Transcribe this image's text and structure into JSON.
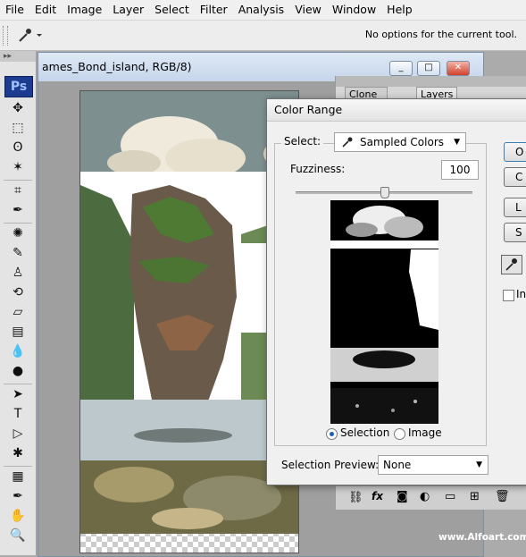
{
  "menu": [
    "File",
    "Edit",
    "Image",
    "Layer",
    "Select",
    "Filter",
    "Analysis",
    "View",
    "Window",
    "Help"
  ],
  "options_bar": {
    "message": "No options for the current tool.",
    "tool_icon": "eyedropper-icon"
  },
  "toolbox": {
    "logo": "Ps",
    "tools": [
      "move-icon",
      "marquee-icon",
      "lasso-icon",
      "magic-wand-icon",
      "crop-icon",
      "eyedropper-icon",
      "healing-brush-icon",
      "brush-icon",
      "clone-stamp-icon",
      "history-brush-icon",
      "eraser-icon",
      "gradient-icon",
      "blur-icon",
      "dodge-icon",
      "path-selection-icon",
      "type-icon",
      "direct-selection-icon",
      "custom-shape-icon",
      "notes-icon",
      "eyedropper-icon",
      "hand-icon",
      "zoom-icon"
    ]
  },
  "document": {
    "title": "ames_Bond_island, RGB/8)",
    "controls": [
      "_",
      "□",
      "✕"
    ]
  },
  "panel": {
    "tabs": [
      "Clone Source",
      "Layers ×"
    ]
  },
  "dialog": {
    "title": "Color Range",
    "select_label": "Select:",
    "select_value": "Sampled Colors",
    "fuzziness_label": "Fuzziness:",
    "fuzziness_value": "100",
    "fuzziness_level": 100,
    "fuzziness_max": 200,
    "radio_selection": "Selection",
    "radio_image": "Image",
    "selected_view": "Selection",
    "preview_label": "Selection Preview:",
    "preview_value": "None",
    "buttons": [
      "O",
      "C",
      "L",
      "S"
    ],
    "invert_label": "In"
  },
  "watermark": "www.Alfoart.com"
}
